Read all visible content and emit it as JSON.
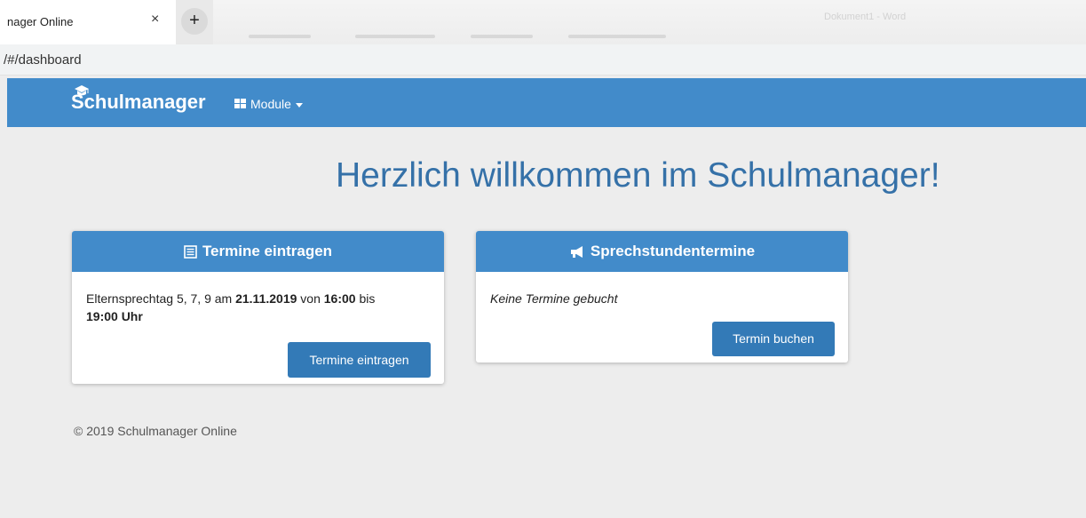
{
  "browser": {
    "tab_title": "nager Online",
    "tab_close": "×",
    "new_tab": "+",
    "blurred_title": "Dokument1 - Word",
    "url": "/#/dashboard"
  },
  "navbar": {
    "brand": "Schulmanager",
    "module_menu": "Module"
  },
  "main": {
    "headline": "Herzlich willkommen im Schulmanager!",
    "cards": [
      {
        "title": "Termine eintragen",
        "icon": "list-icon",
        "text_parts": [
          "Elternsprechtag 5, 7, 9 am ",
          "21.11.2019",
          " von ",
          "16:00",
          " bis ",
          "19:00 Uhr"
        ],
        "button": "Termine eintragen"
      },
      {
        "title": "Sprechstundentermine",
        "icon": "bullhorn-icon",
        "text": "Keine Termine gebucht",
        "button": "Termin buchen"
      }
    ],
    "footer": "© 2019 Schulmanager Online"
  },
  "colors": {
    "primary": "#428bca",
    "button": "#337ab7",
    "headline": "#3571a8",
    "background": "#ededed"
  }
}
